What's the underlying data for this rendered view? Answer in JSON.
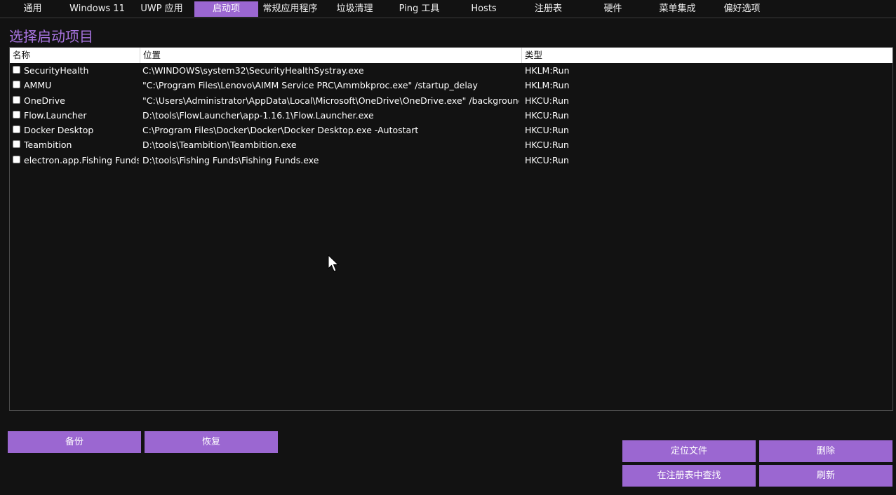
{
  "tabs": [
    {
      "label": "通用",
      "active": false
    },
    {
      "label": "Windows 11",
      "active": false
    },
    {
      "label": "UWP 应用",
      "active": false
    },
    {
      "label": "启动项",
      "active": true
    },
    {
      "label": "常规应用程序",
      "active": false
    },
    {
      "label": "垃圾清理",
      "active": false
    },
    {
      "label": "Ping 工具",
      "active": false
    },
    {
      "label": "Hosts",
      "active": false
    },
    {
      "label": "注册表",
      "active": false
    },
    {
      "label": "硬件",
      "active": false
    },
    {
      "label": "菜单集成",
      "active": false
    },
    {
      "label": "偏好选项",
      "active": false
    }
  ],
  "page": {
    "title": "选择启动项目"
  },
  "table": {
    "columns": [
      "名称",
      "位置",
      "类型"
    ],
    "rows": [
      {
        "name": "SecurityHealth",
        "location": "C:\\WINDOWS\\system32\\SecurityHealthSystray.exe",
        "type": "HKLM:Run",
        "checked": false
      },
      {
        "name": "AMMU",
        "location": "\"C:\\Program Files\\Lenovo\\AIMM Service PRC\\Ammbkproc.exe\" /startup_delay",
        "type": "HKLM:Run",
        "checked": false
      },
      {
        "name": "OneDrive",
        "location": "\"C:\\Users\\Administrator\\AppData\\Local\\Microsoft\\OneDrive\\OneDrive.exe\" /background",
        "type": "HKCU:Run",
        "checked": false
      },
      {
        "name": "Flow.Launcher",
        "location": "D:\\tools\\FlowLauncher\\app-1.16.1\\Flow.Launcher.exe",
        "type": "HKCU:Run",
        "checked": false
      },
      {
        "name": "Docker Desktop",
        "location": "C:\\Program Files\\Docker\\Docker\\Docker Desktop.exe -Autostart",
        "type": "HKCU:Run",
        "checked": false
      },
      {
        "name": "Teambition",
        "location": "D:\\tools\\Teambition\\Teambition.exe",
        "type": "HKCU:Run",
        "checked": false
      },
      {
        "name": "electron.app.Fishing Funds",
        "location": "D:\\tools\\Fishing Funds\\Fishing Funds.exe",
        "type": "HKCU:Run",
        "checked": false
      }
    ]
  },
  "buttons": {
    "backup": "备份",
    "restore": "恢复",
    "locate_file": "定位文件",
    "delete": "删除",
    "find_in_registry": "在注册表中查找",
    "refresh": "刷新"
  },
  "colors": {
    "accent": "#9b67d1",
    "title": "#a874e0",
    "background": "#121212"
  }
}
